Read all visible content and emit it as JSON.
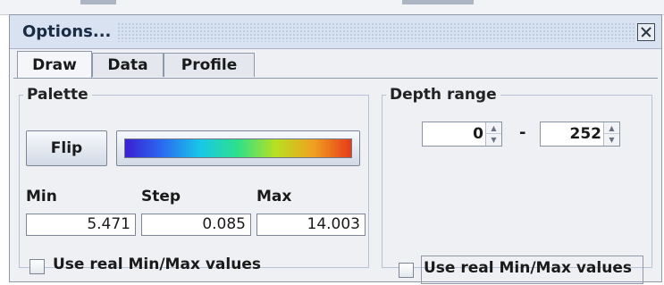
{
  "window": {
    "title": "Options..."
  },
  "tabs": [
    {
      "label": "Draw",
      "active": true
    },
    {
      "label": "Data",
      "active": false
    },
    {
      "label": "Profile",
      "active": false
    }
  ],
  "palette": {
    "legend": "Palette",
    "flip_label": "Flip",
    "min_label": "Min",
    "step_label": "Step",
    "max_label": "Max",
    "min_value": "5.471",
    "step_value": "0.085",
    "max_value": "14.003",
    "real_minmax_label": "Use real Min/Max values",
    "real_minmax_checked": false
  },
  "depth_range": {
    "legend": "Depth range",
    "from_value": "0",
    "separator": "-",
    "to_value": "252",
    "real_minmax_label": "Use real Min/Max values",
    "real_minmax_checked": false
  },
  "icons": {
    "close": "close-icon",
    "spinner_up": "arrow-up-icon",
    "spinner_down": "arrow-down-icon"
  },
  "colors": {
    "titlebar": "#d8e2f0",
    "panel": "#eef0f4",
    "palette_gradient": [
      "#3a1fd4",
      "#2a6cf0",
      "#18c8e8",
      "#2ee08a",
      "#b8e020",
      "#f0a020",
      "#e83a18"
    ]
  }
}
